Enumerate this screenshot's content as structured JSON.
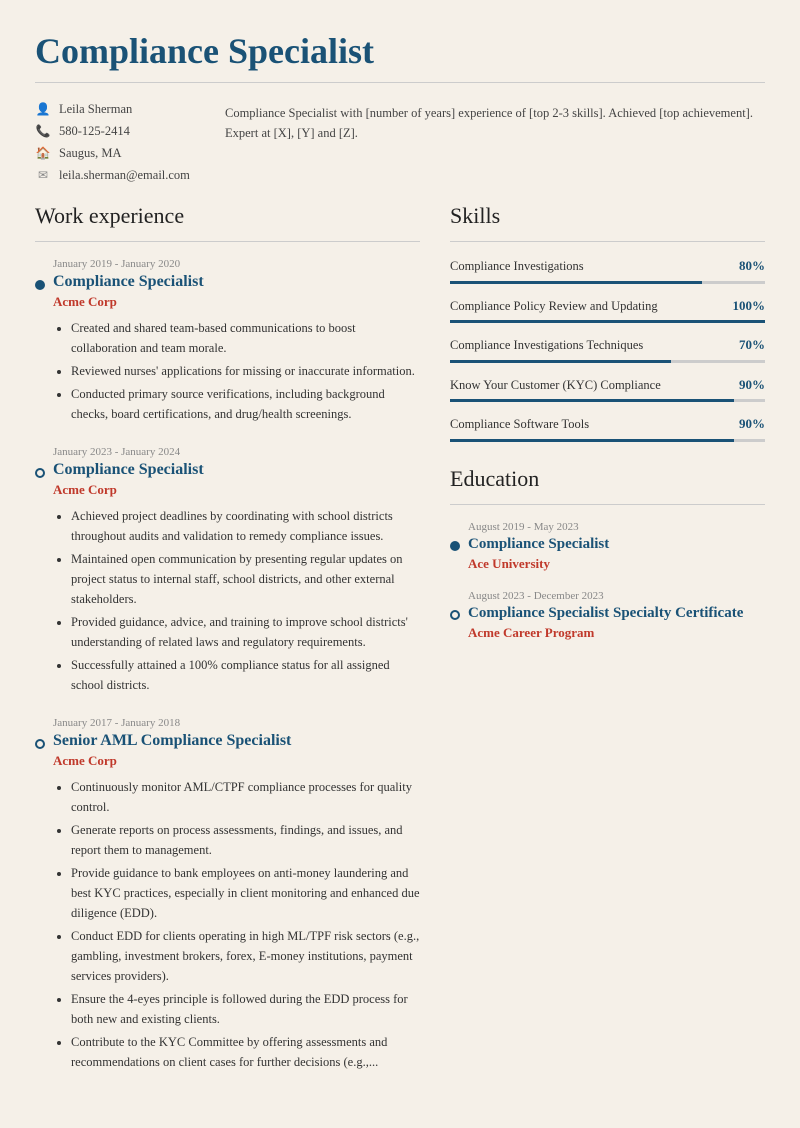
{
  "header": {
    "title": "Compliance Specialist"
  },
  "contact": {
    "name": "Leila Sherman",
    "phone": "580-125-2414",
    "location": "Saugus, MA",
    "email": "leila.sherman@email.com",
    "summary": "Compliance Specialist with [number of years] experience of [top 2-3 skills]. Achieved [top achievement]. Expert at [X], [Y] and [Z]."
  },
  "sections": {
    "work_experience": "Work experience",
    "skills": "Skills",
    "education": "Education"
  },
  "jobs": [
    {
      "date": "January 2019 - January 2020",
      "title": "Compliance Specialist",
      "company": "Acme Corp",
      "dot": "filled",
      "bullets": [
        "Created and shared team-based communications to boost collaboration and team morale.",
        "Reviewed nurses' applications for missing or inaccurate information.",
        "Conducted primary source verifications, including background checks, board certifications, and drug/health screenings."
      ]
    },
    {
      "date": "January 2023 - January 2024",
      "title": "Compliance Specialist",
      "company": "Acme Corp",
      "dot": "empty",
      "bullets": [
        "Achieved project deadlines by coordinating with school districts throughout audits and validation to remedy compliance issues.",
        "Maintained open communication by presenting regular updates on project status to internal staff, school districts, and other external stakeholders.",
        "Provided guidance, advice, and training to improve school districts' understanding of related laws and regulatory requirements.",
        "Successfully attained a 100% compliance status for all assigned school districts."
      ]
    },
    {
      "date": "January 2017 - January 2018",
      "title": "Senior AML Compliance Specialist",
      "company": "Acme Corp",
      "dot": "empty",
      "bullets": [
        "Continuously monitor AML/CTPF compliance processes for quality control.",
        "Generate reports on process assessments, findings, and issues, and report them to management.",
        "Provide guidance to bank employees on anti-money laundering and best KYC practices, especially in client monitoring and enhanced due diligence (EDD).",
        "Conduct EDD for clients operating in high ML/TPF risk sectors (e.g., gambling, investment brokers, forex, E-money institutions, payment services providers).",
        "Ensure the 4-eyes principle is followed during the EDD process for both new and existing clients.",
        "Contribute to the KYC Committee by offering assessments and recommendations on client cases for further decisions (e.g.,..."
      ]
    }
  ],
  "skills": [
    {
      "name": "Compliance Investigations",
      "percent": 80,
      "label": "80%"
    },
    {
      "name": "Compliance Policy Review and Updating",
      "percent": 100,
      "label": "100%"
    },
    {
      "name": "Compliance Investigations Techniques",
      "percent": 70,
      "label": "70%"
    },
    {
      "name": "Know Your Customer (KYC) Compliance",
      "percent": 90,
      "label": "90%"
    },
    {
      "name": "Compliance Software Tools",
      "percent": 90,
      "label": "90%"
    }
  ],
  "education": [
    {
      "date": "August 2019 - May 2023",
      "title": "Compliance Specialist",
      "school": "Ace University",
      "dot": "filled"
    },
    {
      "date": "August 2023 - December 2023",
      "title": "Compliance Specialist Specialty Certificate",
      "school": "Acme Career Program",
      "dot": "empty"
    }
  ]
}
